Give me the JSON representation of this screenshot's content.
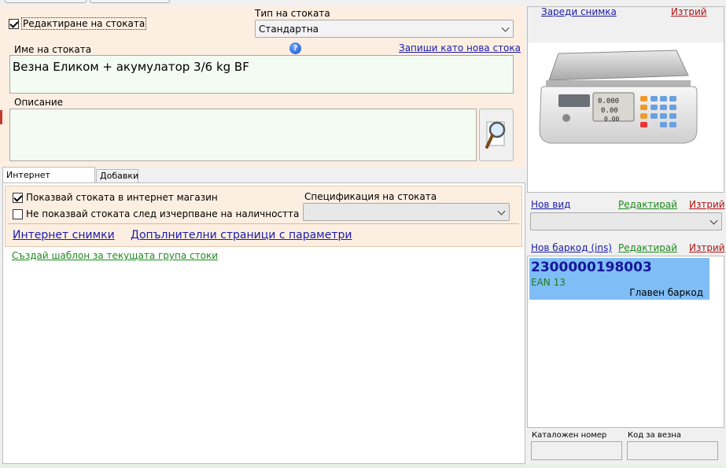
{
  "stock_form": {
    "edit_checkbox_label": "Редактиране на стоката",
    "edit_checked": true,
    "type_label": "Тип на стоката",
    "type_value": "Стандартна",
    "name_label": "Име на стоката",
    "save_as_new_link": "Запиши като нова стока",
    "name_value": "Везна Еликом + акумулатор 3/6 kg BF",
    "description_label": "Описание",
    "description_value": ""
  },
  "tabs": [
    {
      "label": "Интернет параметри",
      "active": true
    },
    {
      "label": "Добавки",
      "active": false
    }
  ],
  "internet_params": {
    "show_in_shop_label": "Показвай стоката в интернет магазин",
    "show_in_shop_checked": true,
    "hide_when_out_label": "Не показвай стоката след изчерпване на наличността",
    "hide_when_out_checked": false,
    "spec_label": "Спецификация на стоката",
    "spec_value": "",
    "internet_images_link": "Интернет снимки",
    "extra_pages_link": "Допълнителни страници с параметри",
    "create_template_link": "Създай шаблон за текущата група стоки"
  },
  "image_panel": {
    "load_image_link": "Зареди снимка",
    "delete_link": "Изтрий"
  },
  "variant": {
    "new_link": "Нов вид",
    "edit_link": "Редактирай",
    "delete_link": "Изтрий",
    "value": ""
  },
  "barcodes": {
    "new_link": "Нов баркод (ins)",
    "edit_link": "Редактирай",
    "delete_link": "Изтрий",
    "items": [
      {
        "code": "2300000198003",
        "type": "EAN 13",
        "note": "Главен баркод"
      }
    ]
  },
  "bottom_fields": {
    "catalog_label": "Каталожен номер",
    "catalog_value": "",
    "scale_code_label": "Код за везна",
    "scale_code_value": ""
  },
  "colors": {
    "form_bg": "#fcefe2",
    "field_bg": "#f4fbf3",
    "barcode_bg": "#7fbdf6"
  },
  "icons": [
    "info-icon",
    "magnifier-icon",
    "chevron-down-icon",
    "scale-product-image"
  ]
}
